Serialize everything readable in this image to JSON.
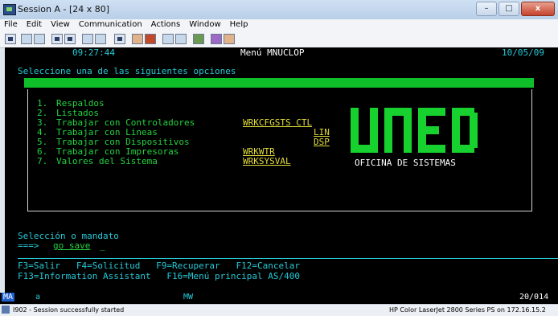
{
  "window": {
    "title": "Session A - [24 x 80]",
    "controls": [
      "–",
      "□",
      "x"
    ]
  },
  "menu": [
    "File",
    "Edit",
    "View",
    "Communication",
    "Actions",
    "Window",
    "Help"
  ],
  "screen": {
    "time": "09:27:44",
    "menu_name": "Menú MNUCLOP",
    "date": "10/05/09",
    "prompt": "Seleccione una de las siguientes opciones",
    "options": [
      {
        "num": "1.",
        "label": "Respaldos",
        "cmd": ""
      },
      {
        "num": "2.",
        "label": "Listados",
        "cmd": ""
      },
      {
        "num": "3.",
        "label": "Trabajar con Controladores",
        "cmd": "WRKCFGSTS CTL"
      },
      {
        "num": "4.",
        "label": "Trabajar con Lineas",
        "cmd": "LIN"
      },
      {
        "num": "5.",
        "label": "Trabajar con Dispositivos",
        "cmd": "DSP"
      },
      {
        "num": "6.",
        "label": "Trabajar con Impresoras",
        "cmd": "WRKWTR"
      },
      {
        "num": "7.",
        "label": "Valores del Sistema",
        "cmd": "WRKSYSVAL"
      }
    ],
    "logo_text": "UNED",
    "logo_caption": "OFICINA DE SISTEMAS",
    "selection_label": "Selección o mandato",
    "input_prompt": "===>",
    "input_value": "go save",
    "fkeys_line1": "F3=Salir   F4=Solicitud   F9=Recuperar   F12=Cancelar",
    "fkeys_line2": "F13=Information Assistant   F16=Menú principal AS/400"
  },
  "oia": {
    "left": "MA",
    "mode": "a",
    "mid": "MW",
    "cursor": "20/014"
  },
  "statusbar": {
    "message": "I902 - Session successfully started",
    "printer": "HP Color LaserJet 2800 Series PS on 172.16.15.2"
  }
}
